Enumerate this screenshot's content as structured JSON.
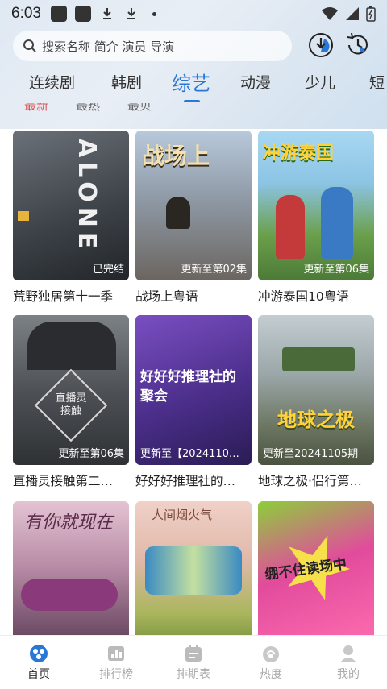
{
  "status_bar": {
    "time": "6:03"
  },
  "search": {
    "placeholder": "搜索名称 简介 演员 导演"
  },
  "tabs": [
    {
      "label": "连续剧",
      "active": false
    },
    {
      "label": "韩剧",
      "active": false
    },
    {
      "label": "综艺",
      "active": true
    },
    {
      "label": "动漫",
      "active": false
    },
    {
      "label": "少儿",
      "active": false
    },
    {
      "label": "短",
      "active": false
    }
  ],
  "subtabs": [
    {
      "label": "最新",
      "active": true
    },
    {
      "label": "最热",
      "active": false
    },
    {
      "label": "最贝",
      "active": false
    }
  ],
  "cards": [
    {
      "title": "荒野独居第十一季",
      "badge": "已完结",
      "poster_text": "ALONE",
      "color_a": "#5a6068",
      "color_b": "#2c3036"
    },
    {
      "title": "战场上粤语",
      "badge": "更新至第02集",
      "poster_text": "战场上",
      "color_a": "#b7c7d8",
      "color_b": "#6e6a66"
    },
    {
      "title": "冲游泰国10粤语",
      "badge": "更新至第06集",
      "poster_text": "冲游泰国",
      "color_a": "#9fd1ef",
      "color_b": "#6fa04c"
    },
    {
      "title": "直播灵接触第二…",
      "badge": "更新至第06集",
      "poster_text": "直播灵接触",
      "color_a": "#6b6f74",
      "color_b": "#3a3d41"
    },
    {
      "title": "好好好推理社的…",
      "badge": "更新至【2024110…",
      "poster_text": "好好好推理社的聚会",
      "color_a": "#6a3cae",
      "color_b": "#3a2a6a"
    },
    {
      "title": "地球之极·侣行第…",
      "badge": "更新至20241105期",
      "poster_text": "地球之极",
      "color_a": "#b9c4c8",
      "color_b": "#5d6a55"
    },
    {
      "title": "",
      "badge": "",
      "poster_text": "有你就现在",
      "color_a": "#d4a8c0",
      "color_b": "#5a3a55"
    },
    {
      "title": "",
      "badge": "",
      "poster_text": "人间烟火气",
      "color_a": "#e9c2b8",
      "color_b": "#a5b05a"
    },
    {
      "title": "",
      "badge": "",
      "poster_text": "绷不住读场中",
      "color_a": "#e24b9c",
      "color_b": "#8ccf3a"
    }
  ],
  "bottom_nav": [
    {
      "label": "首页",
      "icon": "home-icon",
      "active": true
    },
    {
      "label": "排行榜",
      "icon": "ranking-icon",
      "active": false
    },
    {
      "label": "排期表",
      "icon": "schedule-icon",
      "active": false
    },
    {
      "label": "热度",
      "icon": "hot-icon",
      "active": false
    },
    {
      "label": "我的",
      "icon": "profile-icon",
      "active": false
    }
  ],
  "colors": {
    "accent": "#2a78d6",
    "subtab_active": "#e35555"
  }
}
